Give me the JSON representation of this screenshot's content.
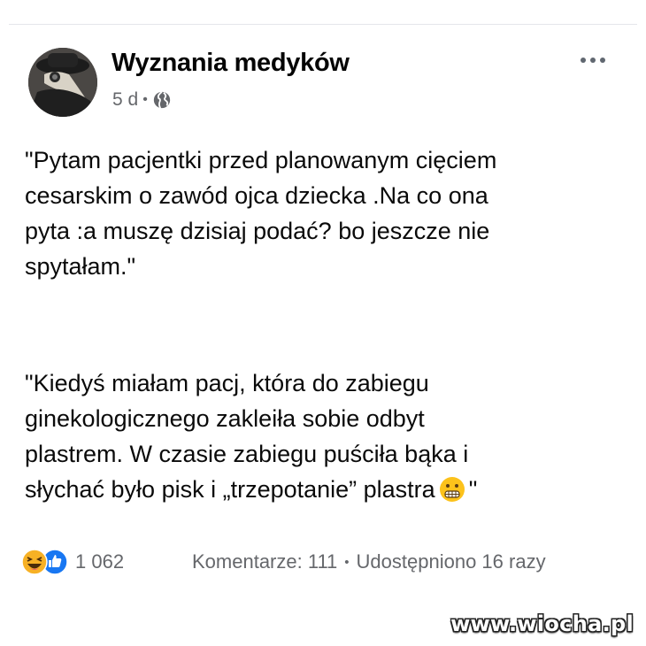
{
  "post": {
    "page_name": "Wyznania medyków",
    "time": "5 d",
    "separator": "•",
    "privacy_icon": "globe-icon",
    "more_icon": "more-horizontal-icon",
    "avatar_icon": "plague-doctor-avatar"
  },
  "content": {
    "paragraph1": [
      "\"Pytam pacjentki przed planowanym cięciem",
      "cesarskim o zawód ojca dziecka .Na co ona",
      "pyta :a muszę dzisiaj podać? bo jeszcze nie",
      "spytałam.\""
    ],
    "paragraph2": [
      "\"Kiedyś miałam pacj, która do zabiegu",
      "ginekologicznego zakleiła sobie odbyt",
      "plastrem. W czasie zabiegu puściła bąka i"
    ],
    "paragraph2_last_line": "słychać było pisk i „trzepotanie” plastra",
    "paragraph2_end": "\"",
    "emoji_icon": "grimacing-face-icon"
  },
  "footer": {
    "reaction_icons": [
      "haha-reaction-icon",
      "like-reaction-icon"
    ],
    "reaction_count": "1 062",
    "comments": "Komentarze: 111",
    "separator": "•",
    "shares": "Udostępniono 16 razy"
  },
  "watermark": "www.wiocha.pl",
  "colors": {
    "secondary_text": "#65676b",
    "like_blue": "#1877f2",
    "haha_yellow": "#f7b125"
  }
}
